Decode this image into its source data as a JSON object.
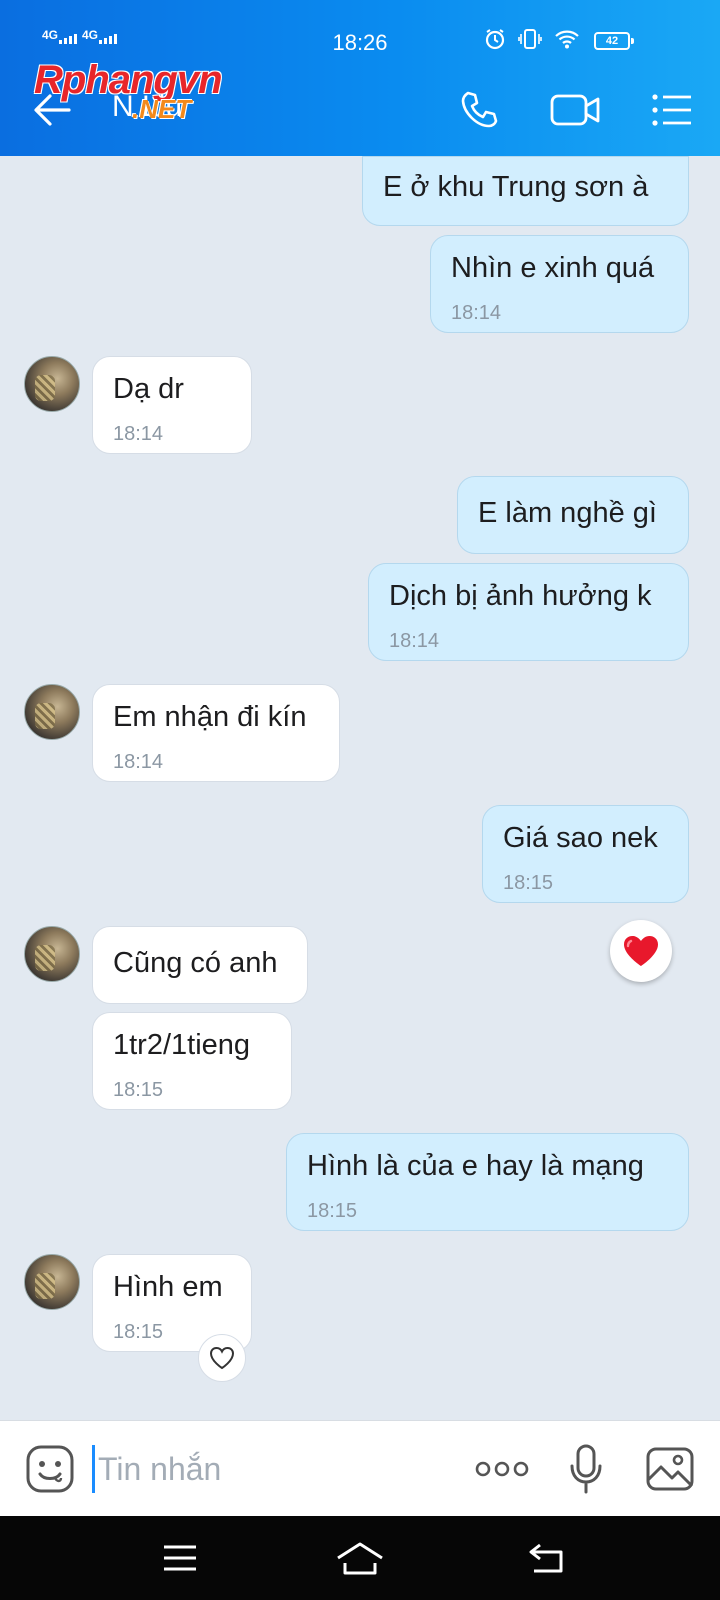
{
  "status_bar": {
    "network_1": "4G",
    "network_2": "4G",
    "time": "18:26",
    "battery": "42"
  },
  "header": {
    "contact_name": "N   Liu",
    "watermark": "Rphangvn",
    "watermark_suffix": ".NET",
    "icons": [
      "back-arrow-icon",
      "phone-icon",
      "video-icon",
      "menu-list-icon"
    ]
  },
  "messages": [
    {
      "dir": "out",
      "text": "E ở  khu Trung sơn à",
      "time": ""
    },
    {
      "dir": "out",
      "text": "Nhìn e xinh quá",
      "time": "18:14"
    },
    {
      "dir": "in",
      "text": "Dạ dr",
      "time": "18:14"
    },
    {
      "dir": "out",
      "text": "E làm nghề gì",
      "time": ""
    },
    {
      "dir": "out",
      "text": "Dịch bị ảnh hưởng k",
      "time": "18:14"
    },
    {
      "dir": "in",
      "text": "Em nhận đi kín",
      "time": "18:14"
    },
    {
      "dir": "out",
      "text": "Giá sao nek",
      "time": "18:15"
    },
    {
      "dir": "in",
      "text": "Cũng có anh",
      "time": ""
    },
    {
      "dir": "in",
      "text": "1tr2/1tieng",
      "time": "18:15"
    },
    {
      "dir": "out",
      "text": "Hình là của e hay là mạng",
      "time": "18:15"
    },
    {
      "dir": "in",
      "text": "Hình em",
      "time": "18:15"
    }
  ],
  "reactions": {
    "heart": "heart-reaction-icon",
    "like": "heart-outline-icon"
  },
  "composer": {
    "placeholder": "Tin nhắn",
    "icons": [
      "emoji-icon",
      "more-dots-icon",
      "microphone-icon",
      "image-icon"
    ]
  },
  "colors": {
    "header_start": "#0a6ee0",
    "header_end": "#1aa8f5",
    "outgoing_bubble": "#d2eefe",
    "incoming_bubble": "#ffffff",
    "chat_background": "#e2e9f1",
    "heart": "#e8182c"
  }
}
